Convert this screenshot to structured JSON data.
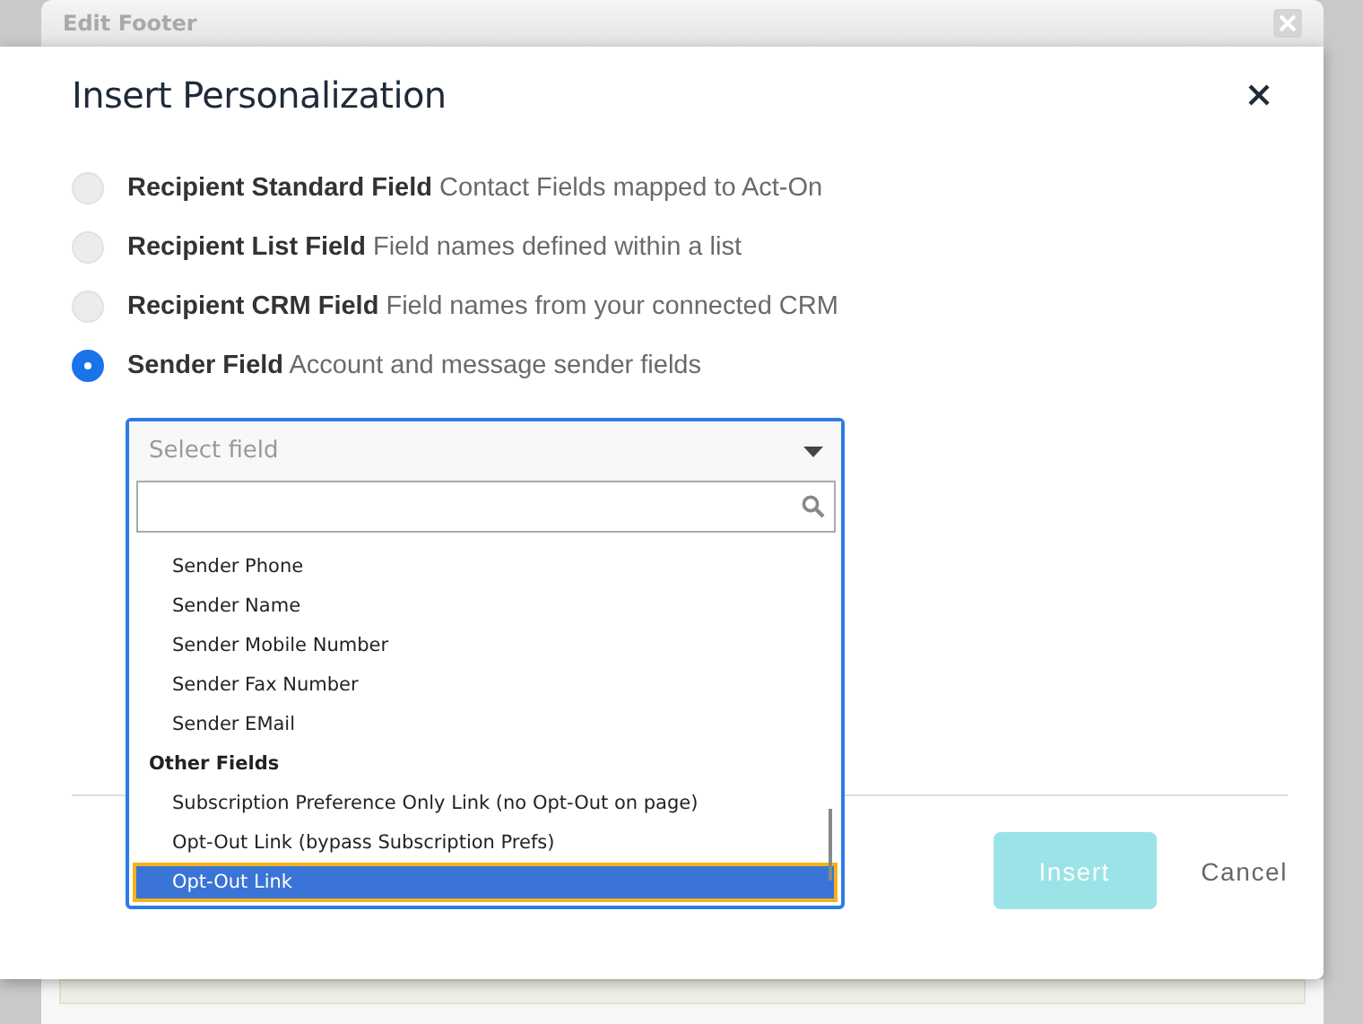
{
  "background_dialog": {
    "title": "Edit Footer"
  },
  "dialog": {
    "title": "Insert Personalization"
  },
  "field_types": [
    {
      "label": "Recipient Standard Field",
      "description": "Contact Fields mapped to Act-On",
      "selected": false
    },
    {
      "label": "Recipient List Field",
      "description": "Field names defined within a list",
      "selected": false
    },
    {
      "label": "Recipient CRM Field",
      "description": "Field names from your connected CRM",
      "selected": false
    },
    {
      "label": "Sender Field",
      "description": "Account and message sender fields",
      "selected": true
    }
  ],
  "field_select": {
    "placeholder": "Select field",
    "options": [
      {
        "kind": "option",
        "label": "Sender Phone",
        "selected": false
      },
      {
        "kind": "option",
        "label": "Sender Name",
        "selected": false
      },
      {
        "kind": "option",
        "label": "Sender Mobile Number",
        "selected": false
      },
      {
        "kind": "option",
        "label": "Sender Fax Number",
        "selected": false
      },
      {
        "kind": "option",
        "label": "Sender EMail",
        "selected": false
      },
      {
        "kind": "group",
        "label": "Other Fields",
        "selected": false
      },
      {
        "kind": "option",
        "label": "Subscription Preference Only Link (no Opt-Out on page)",
        "selected": false
      },
      {
        "kind": "option",
        "label": "Opt-Out Link (bypass Subscription Prefs)",
        "selected": false
      },
      {
        "kind": "option",
        "label": "Opt-Out Link",
        "selected": true
      }
    ]
  },
  "buttons": [
    {
      "kind": "primary",
      "label": "Insert",
      "disabled": true
    },
    {
      "kind": "link",
      "label": "Cancel",
      "disabled": false
    }
  ]
}
